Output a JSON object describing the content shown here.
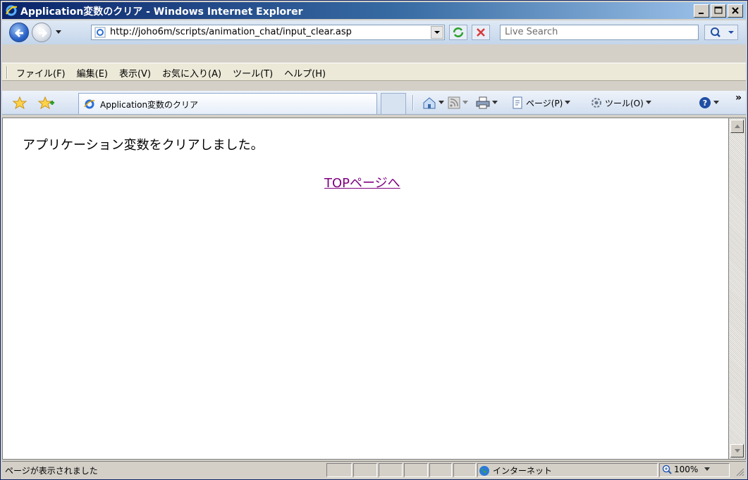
{
  "window": {
    "title": "Application変数のクリア - Windows Internet Explorer"
  },
  "nav": {
    "address": "http://joho6m/scripts/animation_chat/input_clear.asp",
    "search_placeholder": "Live Search"
  },
  "menu": {
    "items": [
      "ファイル(F)",
      "編集(E)",
      "表示(V)",
      "お気に入り(A)",
      "ツール(T)",
      "ヘルプ(H)"
    ]
  },
  "tabs": {
    "active_label": "Application変数のクリア"
  },
  "commands": {
    "page_label": "ページ(P)",
    "tools_label": "ツール(O)"
  },
  "content": {
    "message": "アプリケーション変数をクリアしました。",
    "link_label": "TOPページへ"
  },
  "status": {
    "text": "ページが表示されました",
    "zone": "インターネット",
    "zoom": "100%"
  },
  "colors": {
    "link_visited": "#800080",
    "titlebar": "#0a246a"
  }
}
